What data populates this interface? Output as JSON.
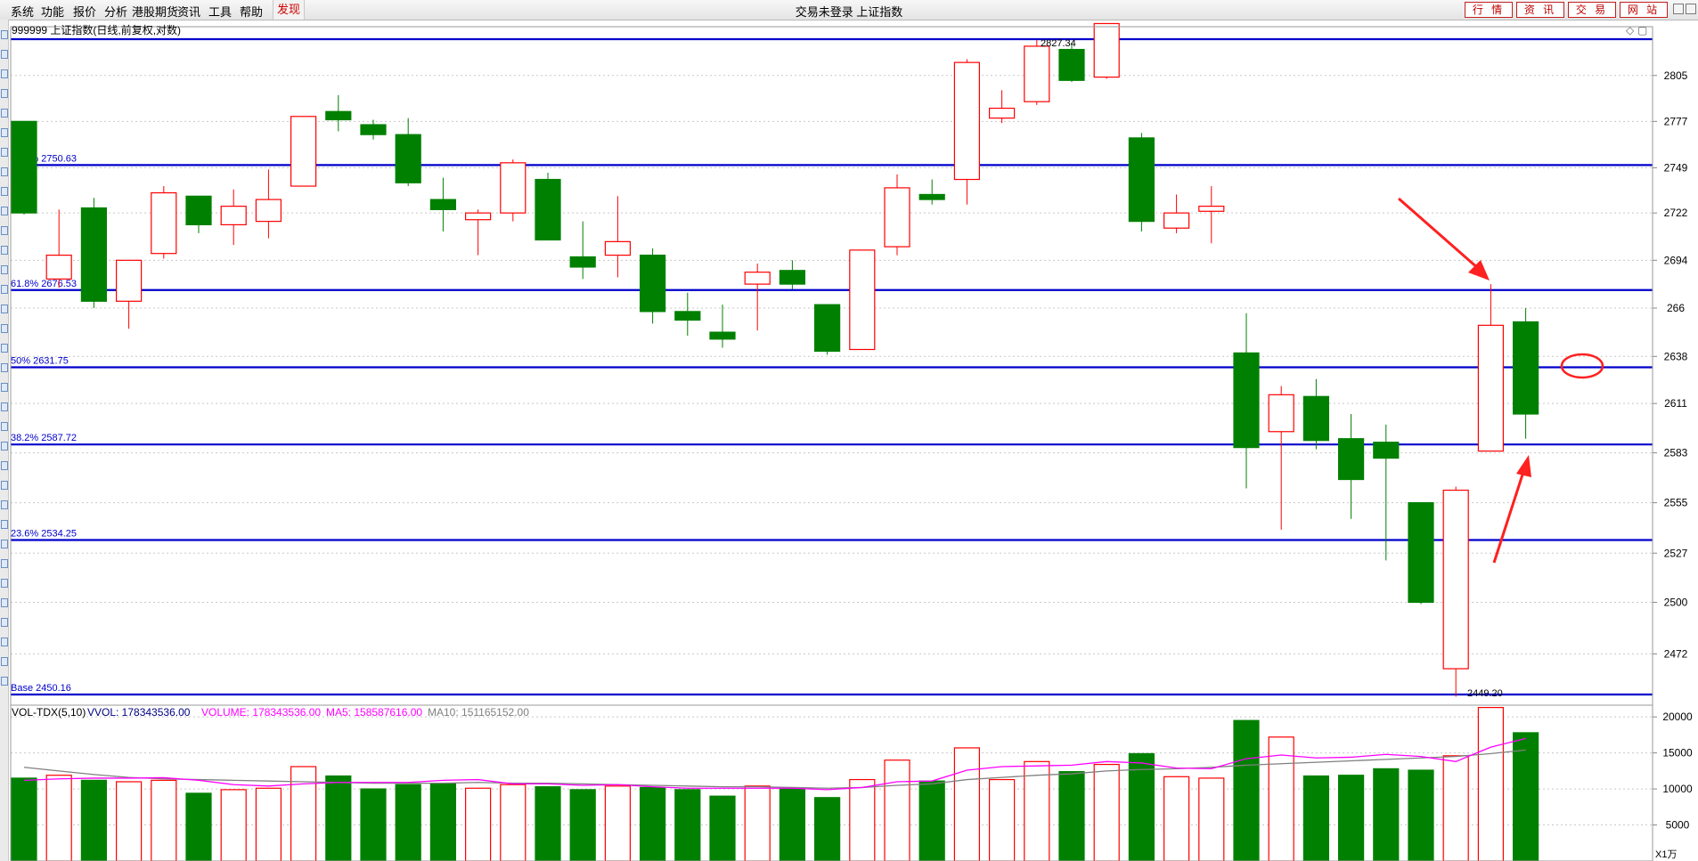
{
  "menu": {
    "items": [
      "系统",
      "功能",
      "报价",
      "分析",
      "港股期货",
      "资讯",
      "工具",
      "帮助"
    ],
    "active_item": "发现"
  },
  "window": {
    "title": "交易未登录   上证指数"
  },
  "toolbar_buttons": [
    "行 情",
    "资 讯",
    "交 易",
    "网 站"
  ],
  "chart_header": "999999 上证指数(日线,前复权,对数)",
  "indicator": {
    "name": "VOL-TDX(5,10)",
    "vvol": "VVOL: 178343536.00",
    "volume": "VOLUME: 178343536.00",
    "ma5": "MA5: 158587616.00",
    "ma10": "MA10: 151165152.00",
    "unit": "X1万"
  },
  "colors": {
    "up": "#ff0000",
    "down": "#008000",
    "fib_line": "#0000cc",
    "ma5": "#ff00ff",
    "ma10": "#808080",
    "arrow": "#ff2020"
  },
  "chart_data": {
    "type": "candlestick",
    "price_axis": {
      "scale": "log",
      "ticks": [
        2805,
        2777,
        2749,
        2722,
        2694,
        "266",
        2638,
        2611,
        2583,
        2555,
        2527,
        2500,
        2472
      ]
    },
    "volume_axis": {
      "unit": "X1万",
      "ticks": [
        20000,
        15000,
        10000,
        5000
      ]
    },
    "fib_levels": [
      {
        "label": "",
        "value": 2827.34
      },
      {
        "label": "80.9% 2750.63",
        "value": 2750.63
      },
      {
        "label": "61.8% 2676.53",
        "value": 2676.53
      },
      {
        "label": "50% 2631.75",
        "value": 2631.75
      },
      {
        "label": "38.2% 2587.72",
        "value": 2587.72
      },
      {
        "label": "23.6% 2534.25",
        "value": 2534.25
      },
      {
        "label": "Base 2450.16",
        "value": 2450.16
      }
    ],
    "annotations": {
      "high_label": "2827.34",
      "low_label": "2449.20"
    },
    "candles": [
      {
        "o": 2777,
        "h": 2777,
        "c": 2722,
        "l": 2721,
        "v": 11500
      },
      {
        "o": 2683,
        "h": 2724,
        "c": 2697,
        "l": 2678,
        "v": 11900
      },
      {
        "o": 2725,
        "h": 2731,
        "c": 2670,
        "l": 2666,
        "v": 11200
      },
      {
        "o": 2670,
        "h": 2694,
        "c": 2694,
        "l": 2654,
        "v": 11000
      },
      {
        "o": 2698,
        "h": 2738,
        "c": 2734,
        "l": 2695,
        "v": 11200
      },
      {
        "o": 2732,
        "h": 2732,
        "c": 2715,
        "l": 2710,
        "v": 9400
      },
      {
        "o": 2715,
        "h": 2736,
        "c": 2726,
        "l": 2703,
        "v": 9900
      },
      {
        "o": 2717,
        "h": 2748,
        "c": 2730,
        "l": 2707,
        "v": 10100
      },
      {
        "o": 2738,
        "h": 2780,
        "c": 2780,
        "l": 2738,
        "v": 13100
      },
      {
        "o": 2783,
        "h": 2793,
        "c": 2778,
        "l": 2771,
        "v": 11800
      },
      {
        "o": 2775,
        "h": 2778,
        "c": 2769,
        "l": 2766,
        "v": 10000
      },
      {
        "o": 2769,
        "h": 2779,
        "c": 2740,
        "l": 2738,
        "v": 10600
      },
      {
        "o": 2730,
        "h": 2743,
        "c": 2724,
        "l": 2711,
        "v": 10800
      },
      {
        "o": 2718,
        "h": 2724,
        "c": 2722,
        "l": 2697,
        "v": 10100
      },
      {
        "o": 2722,
        "h": 2754,
        "c": 2752,
        "l": 2717,
        "v": 10600
      },
      {
        "o": 2742,
        "h": 2746,
        "c": 2706,
        "l": 2706,
        "v": 10300
      },
      {
        "o": 2696,
        "h": 2717,
        "c": 2690,
        "l": 2683,
        "v": 9900
      },
      {
        "o": 2697,
        "h": 2732,
        "c": 2705,
        "l": 2684,
        "v": 10400
      },
      {
        "o": 2697,
        "h": 2701,
        "c": 2664,
        "l": 2657,
        "v": 10200
      },
      {
        "o": 2664,
        "h": 2675,
        "c": 2659,
        "l": 2650,
        "v": 9900
      },
      {
        "o": 2652,
        "h": 2668,
        "c": 2648,
        "l": 2643,
        "v": 9000
      },
      {
        "o": 2680,
        "h": 2692,
        "c": 2687,
        "l": 2653,
        "v": 10400
      },
      {
        "o": 2688,
        "h": 2694,
        "c": 2680,
        "l": 2677,
        "v": 10000
      },
      {
        "o": 2668,
        "h": 2668,
        "c": 2641,
        "l": 2639,
        "v": 8800
      },
      {
        "o": 2642,
        "h": 2700,
        "c": 2700,
        "l": 2642,
        "v": 11300
      },
      {
        "o": 2702,
        "h": 2745,
        "c": 2737,
        "l": 2697,
        "v": 14000
      },
      {
        "o": 2733,
        "h": 2742,
        "c": 2730,
        "l": 2727,
        "v": 11100
      },
      {
        "o": 2742,
        "h": 2815,
        "c": 2813,
        "l": 2727,
        "v": 15700
      },
      {
        "o": 2779,
        "h": 2796,
        "c": 2785,
        "l": 2776,
        "v": 11300
      },
      {
        "o": 2789,
        "h": 2827,
        "c": 2823,
        "l": 2787,
        "v": 13800
      },
      {
        "o": 2821,
        "h": 2825,
        "c": 2802,
        "l": 2801,
        "v": 12400
      },
      {
        "o": 2804,
        "h": 2837,
        "c": 2837,
        "l": 2803,
        "v": 13400
      },
      {
        "o": 2767,
        "h": 2770,
        "c": 2717,
        "l": 2711,
        "v": 14900
      },
      {
        "o": 2713,
        "h": 2733,
        "c": 2722,
        "l": 2710,
        "v": 11700
      },
      {
        "o": 2723,
        "h": 2738,
        "c": 2726,
        "l": 2704,
        "v": 11500
      },
      {
        "o": 2640,
        "h": 2663,
        "c": 2586,
        "l": 2563,
        "v": 19500
      },
      {
        "o": 2595,
        "h": 2621,
        "c": 2616,
        "l": 2540,
        "v": 17200
      },
      {
        "o": 2615,
        "h": 2625,
        "c": 2590,
        "l": 2585,
        "v": 11800
      },
      {
        "o": 2591,
        "h": 2605,
        "c": 2568,
        "l": 2546,
        "v": 11900
      },
      {
        "o": 2589,
        "h": 2599,
        "c": 2580,
        "l": 2523,
        "v": 12800
      },
      {
        "o": 2555,
        "h": 2555,
        "c": 2500,
        "l": 2499,
        "v": 12600
      },
      {
        "o": 2464,
        "h": 2564,
        "c": 2562,
        "l": 2449,
        "v": 14600
      },
      {
        "o": 2584,
        "h": 2680,
        "c": 2656,
        "l": 2584,
        "v": 21300
      },
      {
        "o": 2658,
        "h": 2666,
        "c": 2605,
        "l": 2591,
        "v": 17800
      }
    ],
    "ma5": [
      11200,
      11400,
      11500,
      11500,
      11560,
      11200,
      10600,
      10400,
      10700,
      10900,
      10900,
      10900,
      11200,
      11300,
      10700,
      10700,
      10500,
      10600,
      10300,
      10100,
      10100,
      10100,
      10100,
      9900,
      10200,
      11000,
      11100,
      12600,
      13100,
      13200,
      13300,
      13800,
      13600,
      12900,
      12800,
      14200,
      14700,
      14300,
      14400,
      14800,
      14500,
      13800,
      15800,
      17000
    ],
    "ma10": [
      13000,
      12500,
      12000,
      11600,
      11400,
      11300,
      11200,
      11100,
      11000,
      10900,
      10800,
      10800,
      10800,
      10900,
      10800,
      10800,
      10700,
      10600,
      10500,
      10400,
      10300,
      10300,
      10200,
      10100,
      10200,
      10500,
      10700,
      11300,
      11600,
      11900,
      12100,
      12500,
      12700,
      12800,
      13000,
      13300,
      13500,
      13700,
      13900,
      14100,
      14300,
      14500,
      14900,
      15400
    ]
  }
}
